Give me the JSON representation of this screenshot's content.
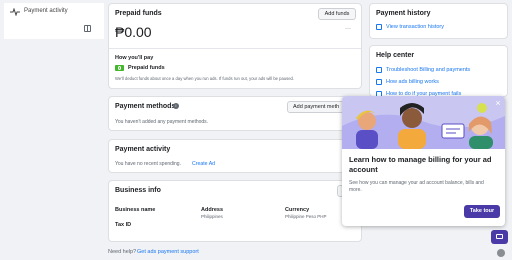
{
  "sidebar": {
    "payment_activity": "Payment activity"
  },
  "prepaid": {
    "title": "Prepaid funds",
    "add_funds": "Add funds",
    "amount": "₱0.00",
    "more": "···",
    "how_pay_title": "How you'll pay",
    "method": "Prepaid funds",
    "note": "We'll deduct funds about once a day when you run ads. If funds run out, your ads will be paused."
  },
  "payment_methods": {
    "title": "Payment methods",
    "info_icon": "info-icon",
    "add_button": "Add payment meth",
    "empty": "You haven't added any payment methods."
  },
  "activity": {
    "title": "Payment activity",
    "empty": "You have no recent spending.",
    "create_ad": "Create Ad"
  },
  "business": {
    "title": "Business info",
    "edit": "E",
    "name_label": "Business name",
    "address_label": "Address",
    "address_value": "Philippines",
    "currency_label": "Currency",
    "currency_value": "Philippine Peso PHP",
    "tax_label": "Tax ID"
  },
  "footer": {
    "need_help": "Need help?",
    "support_link": "Get ads payment support"
  },
  "history": {
    "title": "Payment history",
    "link": "View transaction history"
  },
  "help_center": {
    "title": "Help center",
    "items": [
      "Troubleshoot Billing and payments",
      "How ads billing works",
      "How to do if your payment fails"
    ]
  },
  "popup": {
    "title": "Learn how to manage billing for your ad account",
    "body": "See how you can manage your ad account balance, bills and more.",
    "button": "Take tour",
    "close": "×"
  },
  "colors": {
    "accent": "#1877f2",
    "tour_button": "#4a3aa8",
    "prepaid_badge": "#42b72a"
  }
}
